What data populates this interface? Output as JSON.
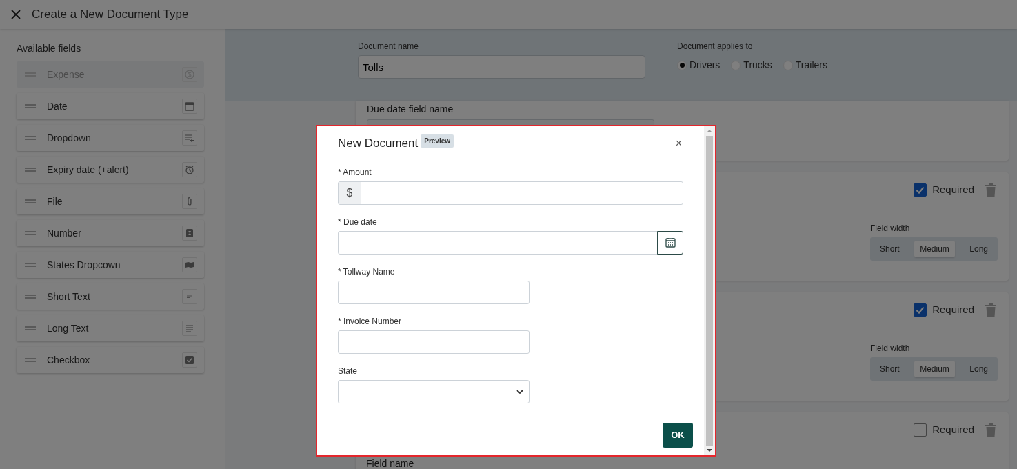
{
  "header": {
    "title": "Create a New Document Type"
  },
  "sidebar": {
    "title": "Available fields",
    "items": [
      {
        "label": "Expense",
        "kind": "expense",
        "disabled": true
      },
      {
        "label": "Date",
        "kind": "date",
        "disabled": false
      },
      {
        "label": "Dropdown",
        "kind": "dropdown",
        "disabled": false
      },
      {
        "label": "Expiry date (+alert)",
        "kind": "expiry",
        "disabled": false
      },
      {
        "label": "File",
        "kind": "file",
        "disabled": false
      },
      {
        "label": "Number",
        "kind": "number",
        "disabled": false
      },
      {
        "label": "States Dropcown",
        "kind": "states",
        "disabled": false
      },
      {
        "label": "Short Text",
        "kind": "short_text",
        "disabled": false
      },
      {
        "label": "Long Text",
        "kind": "long_text",
        "disabled": false
      },
      {
        "label": "Checkbox",
        "kind": "checkbox",
        "disabled": false
      }
    ]
  },
  "document": {
    "name_label": "Document name",
    "name_value": "Tolls",
    "applies_label": "Document applies to",
    "applies_options": [
      {
        "label": "Drivers",
        "selected": true
      },
      {
        "label": "Trucks",
        "selected": false
      },
      {
        "label": "Trailers",
        "selected": false
      }
    ]
  },
  "field_cards": [
    {
      "kind": "due_date",
      "field_label": "Due date field name"
    },
    {
      "kind": "field",
      "required_label": "Required",
      "required": true,
      "width_label": "Field width",
      "width_options": [
        {
          "label": "Short",
          "selected": false
        },
        {
          "label": "Medium",
          "selected": true
        },
        {
          "label": "Long",
          "selected": false
        }
      ]
    },
    {
      "kind": "field",
      "required_label": "Required",
      "required": true,
      "width_label": "Field width",
      "width_options": [
        {
          "label": "Short",
          "selected": false
        },
        {
          "label": "Medium",
          "selected": true
        },
        {
          "label": "Long",
          "selected": false
        }
      ]
    },
    {
      "kind": "field",
      "required_label": "Required",
      "required": false,
      "field_label": "Field name"
    }
  ],
  "modal": {
    "title": "New Document",
    "badge": "Preview",
    "close": "×",
    "ok": "OK",
    "fields": [
      {
        "kind": "currency",
        "label": "* Amount",
        "prefix": "$"
      },
      {
        "kind": "date",
        "label": "* Due date"
      },
      {
        "kind": "text",
        "label": "* Tollway Name"
      },
      {
        "kind": "text",
        "label": "* Invoice Number"
      },
      {
        "kind": "select",
        "label": "State"
      }
    ]
  }
}
